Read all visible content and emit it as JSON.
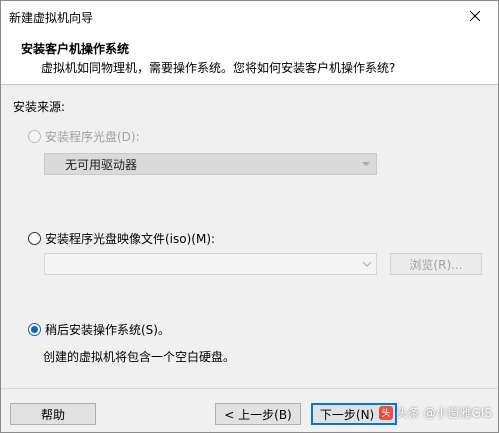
{
  "window": {
    "title": "新建虚拟机向导",
    "close_icon": "close-icon"
  },
  "header": {
    "title": "安装客户机操作系统",
    "subtitle": "虚拟机如同物理机，需要操作系统。您将如何安装客户机操作系统?"
  },
  "install_source": {
    "label": "安装来源:",
    "options": [
      {
        "label": "安装程序光盘(D):",
        "checked": false,
        "enabled": false
      },
      {
        "label": "安装程序光盘映像文件(iso)(M):",
        "checked": false,
        "enabled": true
      },
      {
        "label": "稍后安装操作系统(S)。",
        "checked": true,
        "enabled": true
      }
    ],
    "disc_drive_value": "无可用驱动器",
    "iso_path_value": "",
    "browse_label": "浏览(R)...",
    "later_note": "创建的虚拟机将包含一个空白硬盘。"
  },
  "footer": {
    "help_label": "帮助",
    "back_label": "< 上一步(B)",
    "next_label": "下一步(N) >"
  },
  "watermark": {
    "text": "头条 @小窗雅GIS"
  },
  "colors": {
    "accent": "#0078d7",
    "radio_checked": "#0a64c2",
    "disabled_text": "#a0a0a0"
  }
}
